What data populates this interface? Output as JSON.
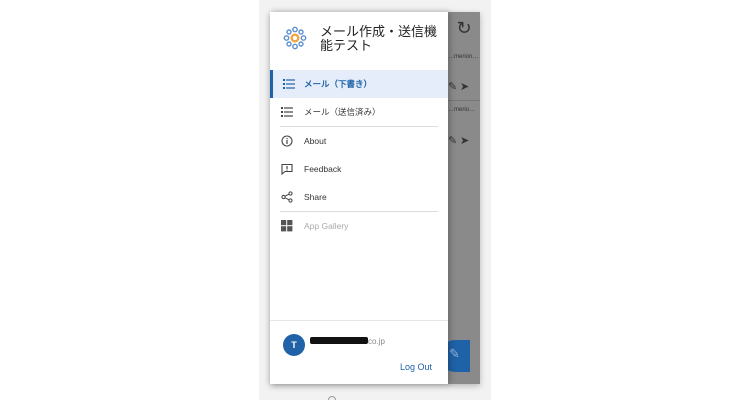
{
  "app": {
    "title": "メール作成・送信機能テスト",
    "refresh_icon": "refresh-icon"
  },
  "background_list": {
    "rows": [
      {
        "subtitle": "…merion…"
      },
      {
        "subtitle": "…merio…"
      }
    ]
  },
  "drawer": {
    "nav_items": [
      {
        "label": "メール（下書き）",
        "icon": "list-icon",
        "active": true
      },
      {
        "label": "メール（送信済み）",
        "icon": "list-icon",
        "active": false
      },
      {
        "label": "About",
        "icon": "info-icon",
        "active": false
      },
      {
        "label": "Feedback",
        "icon": "feedback-icon",
        "active": false
      },
      {
        "label": "Share",
        "icon": "share-icon",
        "active": false
      },
      {
        "label": "App Gallery",
        "icon": "grid-icon",
        "active": false,
        "disabled": true
      }
    ],
    "user": {
      "avatar_initial": "T",
      "email_visible": "co.jp"
    },
    "logout_label": "Log Out"
  },
  "colors": {
    "accent": "#1f62a8",
    "active_bg": "#e4edf9",
    "overlay": "#8a8a8a"
  }
}
